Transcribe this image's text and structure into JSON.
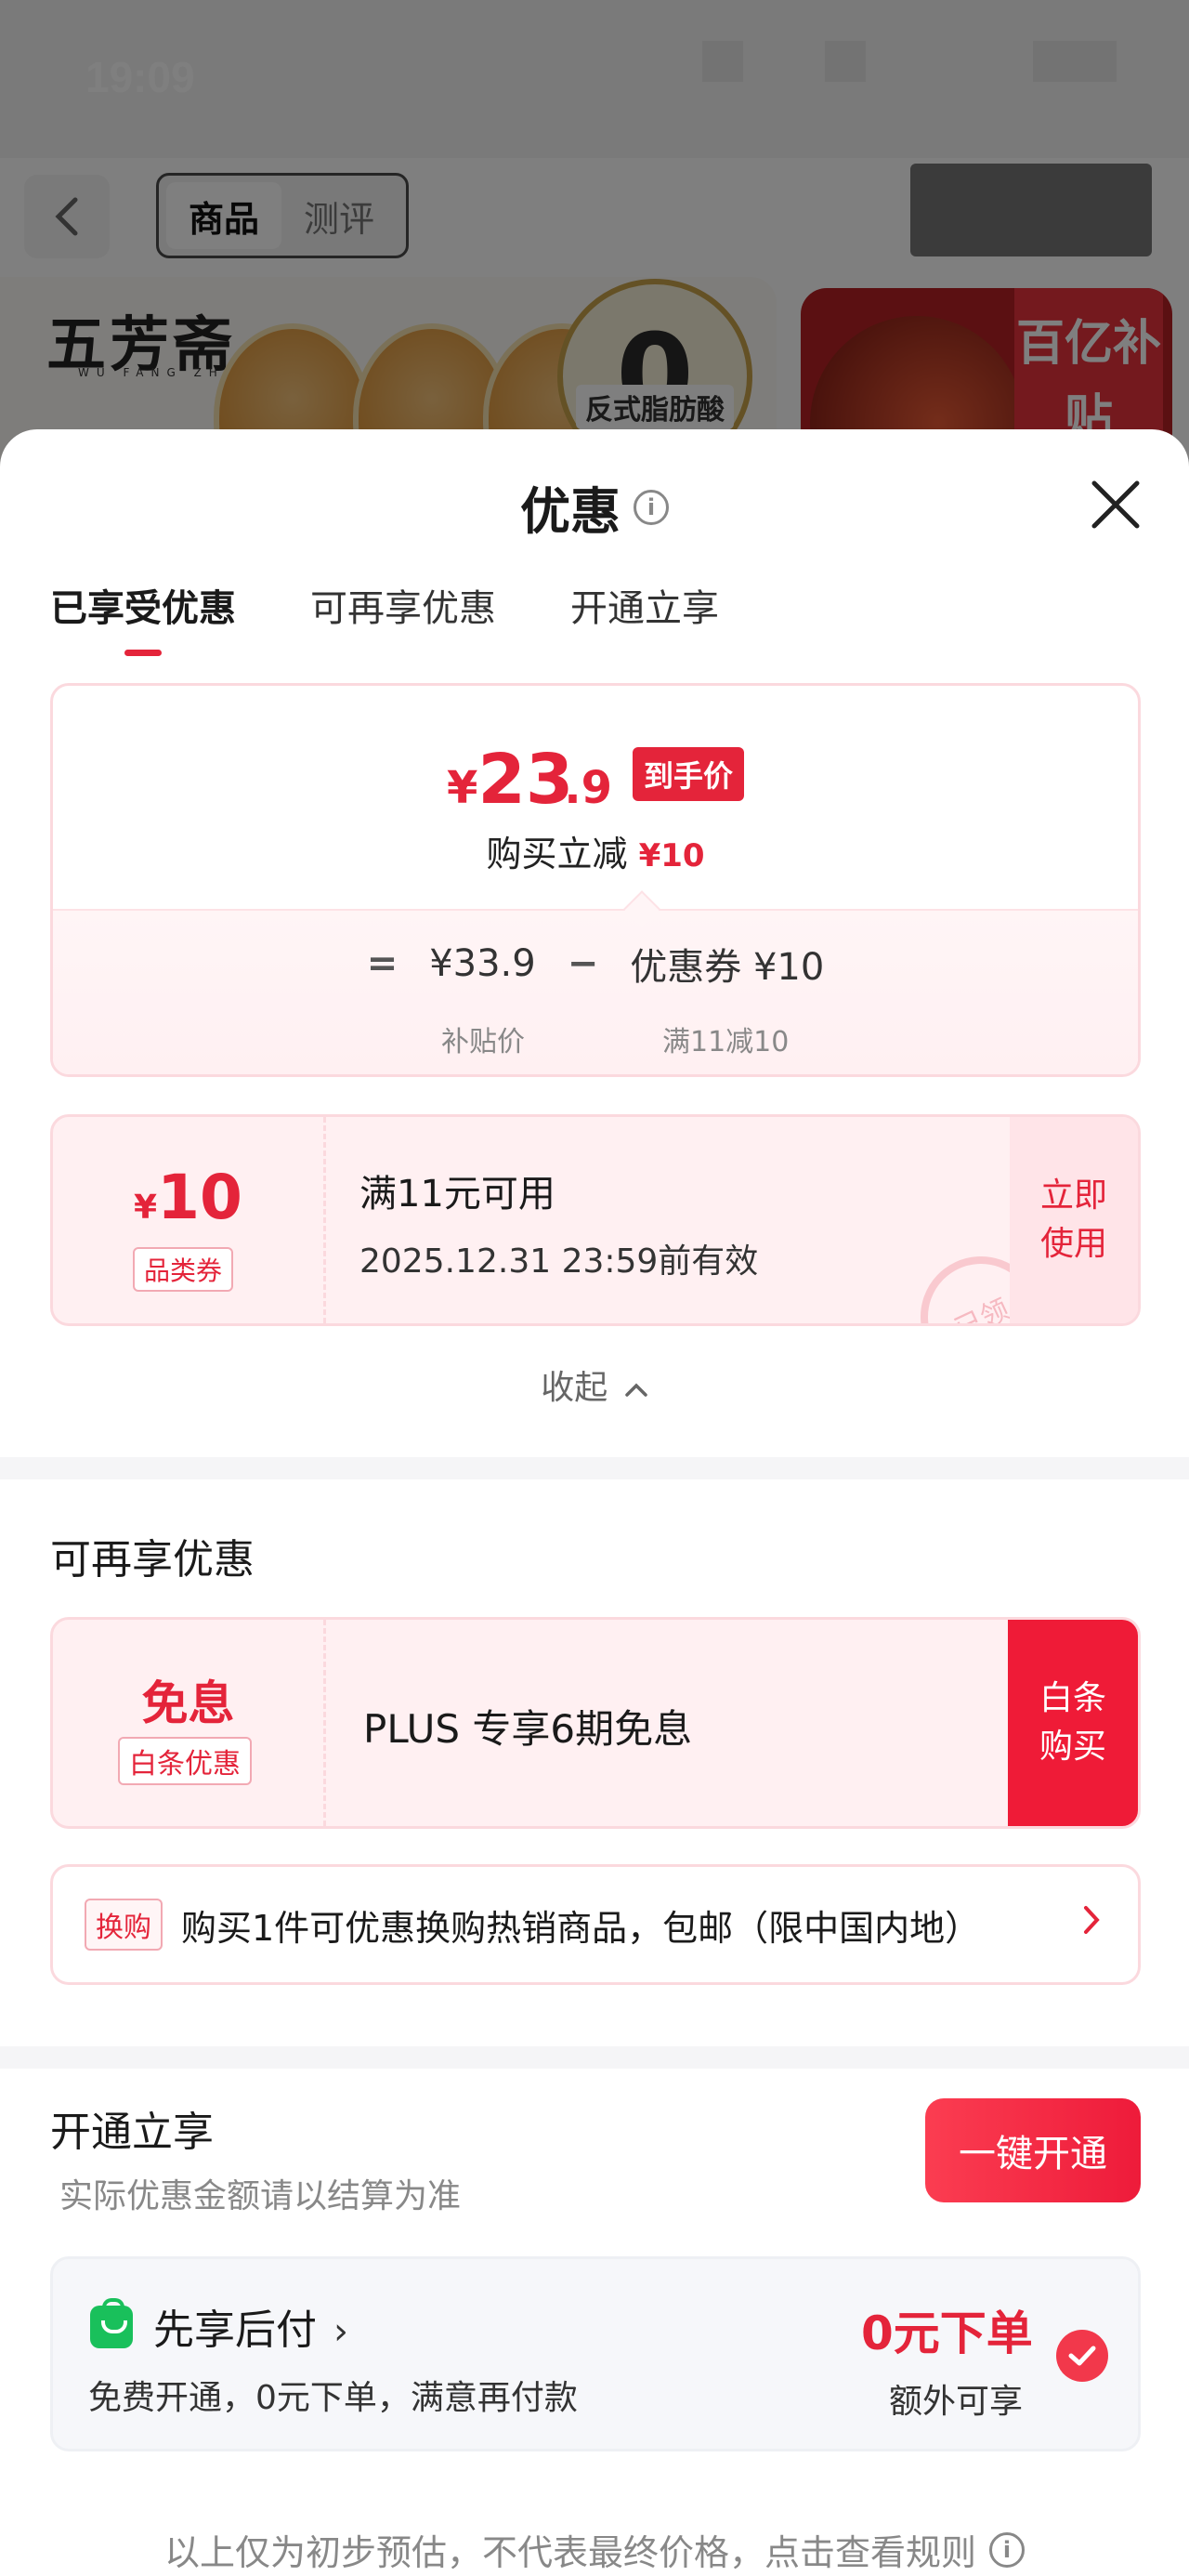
{
  "status_bar": {
    "time": "19:09"
  },
  "background_page": {
    "tabs": [
      "商品",
      "测评"
    ],
    "brand": "五芳斋",
    "brand_sub": "WU FANG ZHAI",
    "seal_text": "反式脂肪酸",
    "seal_number": "0",
    "badge_text": "百亿补贴"
  },
  "sheet": {
    "title": "优惠",
    "tabs": [
      "已享受优惠",
      "可再享优惠",
      "开通立享"
    ],
    "price": {
      "yen": "¥",
      "int": "23",
      "dec": ".9",
      "tag": "到手价",
      "sub_label": "购买立减",
      "sub_value": "¥10"
    },
    "calc": {
      "equals": "=",
      "base": "¥33.9",
      "base_caption": "补贴价",
      "minus": "−",
      "coupon": "优惠券 ¥10",
      "coupon_caption": "满11减10"
    },
    "coupon": {
      "yen": "¥",
      "amount": "10",
      "type": "品类券",
      "condition": "满11元可用",
      "validity": "2025.12.31 23:59前有效",
      "stamp": "已领",
      "action": "立即使用"
    },
    "collapse": "收起",
    "section_more": "可再享优惠",
    "interest_free": {
      "big": "免息",
      "tag": "白条优惠",
      "text": "PLUS 专享6期免息",
      "action": "白条购买"
    },
    "tradein": {
      "tag": "换购",
      "text": "购买1件可优惠换购热销商品，包邮（限中国内地）"
    },
    "section_open": "开通立享",
    "open_note": "实际优惠金额请以结算为准",
    "one_click": "一键开通",
    "plus": {
      "title": "先享后付",
      "sub": "免费开通，0元下单，满意再付款",
      "big": "0元下单",
      "small": "额外可享"
    },
    "footer": "以上仅为初步预估，不代表最终价格，点击查看规则"
  }
}
